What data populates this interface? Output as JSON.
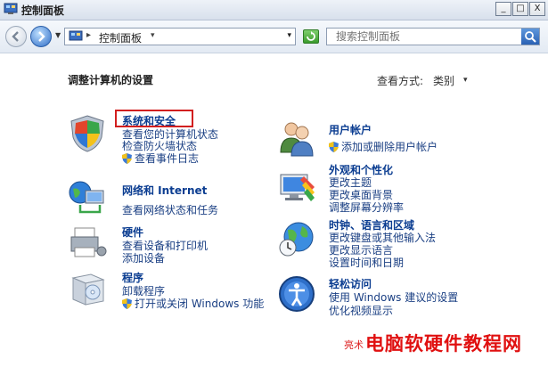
{
  "window": {
    "title": "控制面板"
  },
  "window_buttons": {
    "minimize": "_",
    "maximize": "□",
    "close": "X"
  },
  "address": {
    "crumb": "控制面板",
    "sep": "▸",
    "dropdown": "▾"
  },
  "search": {
    "placeholder": "搜索控制面板"
  },
  "content": {
    "heading": "调整计算机的设置",
    "view_by_label": "查看方式:",
    "view_by_value": "类别",
    "view_by_arrow": "▾"
  },
  "categories": {
    "system_security": {
      "title": "系统和安全",
      "links": [
        "查看您的计算机状态",
        "检查防火墙状态",
        "查看事件日志"
      ]
    },
    "network": {
      "title": "网络和 Internet",
      "links": [
        "查看网络状态和任务"
      ]
    },
    "hardware": {
      "title": "硬件",
      "links": [
        "查看设备和打印机",
        "添加设备"
      ]
    },
    "programs": {
      "title": "程序",
      "links": [
        "卸载程序",
        "打开或关闭 Windows 功能"
      ]
    },
    "user_accounts": {
      "title": "用户帐户",
      "links": [
        "添加或删除用户帐户"
      ]
    },
    "appearance": {
      "title": "外观和个性化",
      "links": [
        "更改主题",
        "更改桌面背景",
        "调整屏幕分辨率"
      ]
    },
    "clock_region": {
      "title": "时钟、语言和区域",
      "links": [
        "更改键盘或其他输入法",
        "更改显示语言",
        "设置时间和日期"
      ]
    },
    "ease_access": {
      "title": "轻松访问",
      "links": [
        "使用 Windows 建议的设置",
        "优化视频显示"
      ]
    }
  },
  "watermark": {
    "small": "亮术",
    "big": "电脑软硬件教程网"
  },
  "icons": [
    "control-panel-icon",
    "back-arrow-icon",
    "forward-arrow-icon",
    "refresh-icon",
    "search-icon",
    "shield-icon",
    "users-icon",
    "monitor-icon",
    "globe-icon",
    "printer-icon",
    "software-box-icon",
    "accessibility-icon"
  ]
}
